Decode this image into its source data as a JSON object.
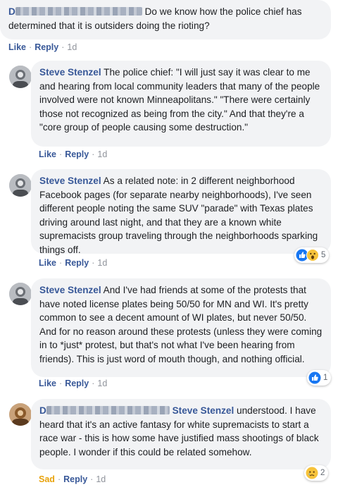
{
  "comments": [
    {
      "author": "D",
      "text": " Do we know how the police chief has determined that it is outsiders doing the rioting?",
      "like": "Like",
      "reply": "Reply",
      "time": "1d"
    },
    {
      "author": "Steve Stenzel",
      "text": " The police chief: \"I will just say it was clear to me and hearing from local community leaders that many of the people involved were not known Minneapolitans.\" \"There were certainly those not recognized as being from the city.\" And that they're a \"core group of people causing some destruction.\"",
      "like": "Like",
      "reply": "Reply",
      "time": "1d"
    },
    {
      "author": "Steve Stenzel",
      "text": " As a related note: in 2 different neighborhood Facebook pages (for separate nearby neighborhoods), I've seen different people noting the same SUV \"parade\" with Texas plates driving around last night, and that they are a known white supremacists group traveling through the neighborhoods sparking things off.",
      "like": "Like",
      "reply": "Reply",
      "time": "1d",
      "reaction_count": "5",
      "reaction_icons": [
        "like-icon",
        "wow-icon"
      ]
    },
    {
      "author": "Steve Stenzel",
      "text": " And I've had friends at some of the protests that have noted license plates being 50/50 for MN and WI. It's pretty common to see a decent amount of WI plates, but never 50/50. And for no reason around these protests (unless they were coming in to *just* protest, but that's not what I've been hearing from friends). This is just word of mouth though, and nothing official.",
      "like": "Like",
      "reply": "Reply",
      "time": "1d",
      "reaction_count": "1",
      "reaction_icons": [
        "like-icon"
      ]
    },
    {
      "author": "D",
      "mention": "Steve Stenzel",
      "text": " understood. I have heard that it's an active fantasy for white supremacists to start a race war - this is how some have justified mass shootings of black people. I wonder if this could be related somehow.",
      "like": "Sad",
      "reply": "Reply",
      "time": "1d",
      "reaction_count": "2",
      "reaction_icons": [
        "sad-icon"
      ]
    }
  ],
  "colors": {
    "link": "#385898",
    "bubble": "#f2f3f5",
    "meta": "#90949c",
    "sad": "#e8a20a",
    "like_blue": "#1877f2"
  }
}
